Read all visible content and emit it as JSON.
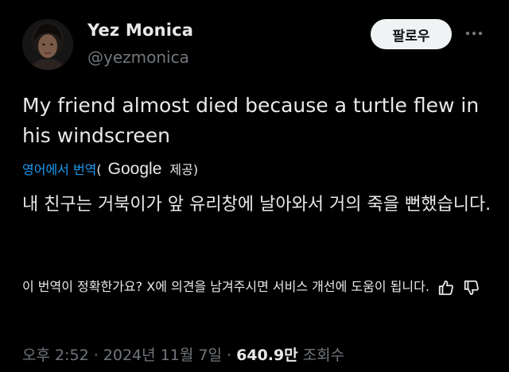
{
  "author": {
    "name": "Yez Monica",
    "handle": "@yezmonica",
    "avatar_icon": "profile-photo"
  },
  "actions": {
    "follow_label": "팔로우",
    "more_icon": "more-horizontal-icon"
  },
  "tweet": {
    "text": "My friend almost died because a turtle flew in his windscreen"
  },
  "translation": {
    "link_label": "영어에서 번역",
    "open_paren": "(",
    "provider": "Google",
    "provider_suffix": "제공)",
    "text": "내 친구는 거북이가 앞 유리창에 날아와서 거의 죽을 뻔했습니다."
  },
  "feedback": {
    "prompt": "이 번역이 정확한가요? X에 의견을 남겨주시면 서비스 개선에 도움이 됩니다.",
    "thumbs_up_icon": "thumbs-up-icon",
    "thumbs_down_icon": "thumbs-down-icon"
  },
  "meta": {
    "time": "오후 2:52",
    "sep1": " · ",
    "date": "2024년 11월 7일",
    "sep2": " · ",
    "views": "640.9만",
    "views_label": " 조회수"
  },
  "colors": {
    "background": "#000000",
    "text": "#e7e9ea",
    "muted": "#71767b",
    "link": "#1d9bf0",
    "button": "#eff3f4"
  }
}
